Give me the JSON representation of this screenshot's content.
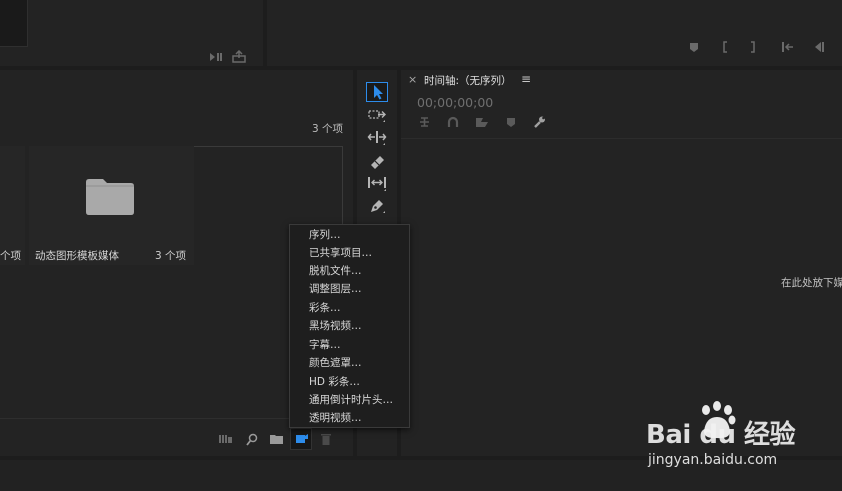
{
  "project_panel": {
    "item_count": "3 个项",
    "cut_label": "个项",
    "folder_name": "动态图形模板媒体",
    "folder_count": "3 个项"
  },
  "timeline": {
    "close": "×",
    "title": "时间轴:（无序列）",
    "menu_icon": "≡",
    "timecode": "00;00;00;00",
    "drop_hint": "在此处放下媒"
  },
  "new_item_menu": {
    "items": [
      "序列…",
      "已共享项目…",
      "脱机文件…",
      "调整图层…",
      "彩条…",
      "黑场视频…",
      "字幕…",
      "颜色遮罩…",
      "HD 彩条…",
      "通用倒计时片头…",
      "透明视频…"
    ]
  },
  "watermark": {
    "brand": "Bai du 经验",
    "url": "jingyan.baidu.com"
  },
  "colors": {
    "accent": "#2d8ceb",
    "panel": "#232323",
    "background": "#1d1d1d"
  }
}
